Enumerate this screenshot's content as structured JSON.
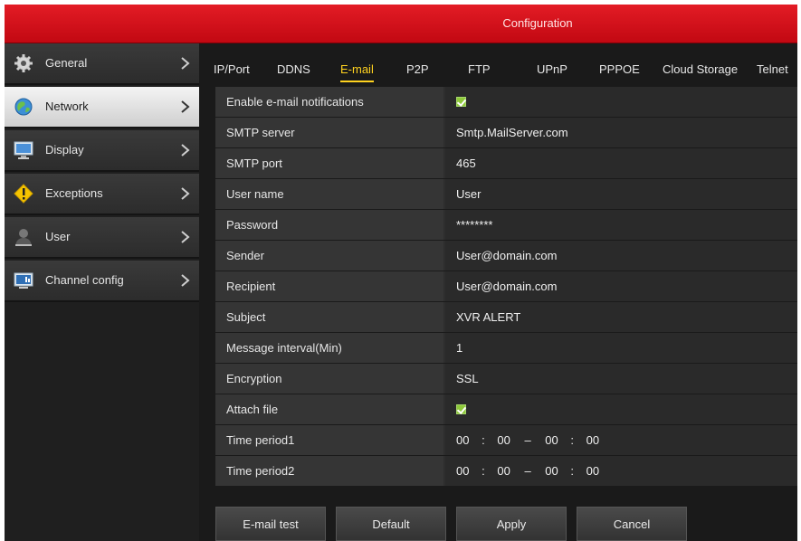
{
  "window": {
    "title": "Configuration"
  },
  "sidebar": {
    "items": [
      {
        "label": "General",
        "icon": "gear-icon"
      },
      {
        "label": "Network",
        "icon": "globe-icon"
      },
      {
        "label": "Display",
        "icon": "monitor-icon"
      },
      {
        "label": "Exceptions",
        "icon": "warning-icon"
      },
      {
        "label": "User",
        "icon": "user-icon"
      },
      {
        "label": "Channel config",
        "icon": "channel-icon"
      }
    ],
    "active": "Network"
  },
  "tabs": [
    {
      "label": "IP/Port"
    },
    {
      "label": "DDNS"
    },
    {
      "label": "E-mail"
    },
    {
      "label": "P2P"
    },
    {
      "label": "FTP"
    },
    {
      "label": "UPnP"
    },
    {
      "label": "PPPOE"
    },
    {
      "label": "Cloud Storage"
    },
    {
      "label": "Telnet"
    }
  ],
  "active_tab": "E-mail",
  "form": {
    "enable_label": "Enable e-mail notifications",
    "enable_checked": true,
    "smtp_server_label": "SMTP server",
    "smtp_server_value": "Smtp.MailServer.com",
    "smtp_port_label": "SMTP port",
    "smtp_port_value": "465",
    "username_label": "User name",
    "username_value": "User",
    "password_label": "Password",
    "password_value": "********",
    "sender_label": "Sender",
    "sender_value": "User@domain.com",
    "recipient_label": "Recipient",
    "recipient_value": "User@domain.com",
    "subject_label": "Subject",
    "subject_value": "XVR ALERT",
    "interval_label": "Message interval(Min)",
    "interval_value": "1",
    "encryption_label": "Encryption",
    "encryption_value": "SSL",
    "attach_label": "Attach file",
    "attach_checked": true,
    "period1_label": "Time period1",
    "period1": {
      "start_h": "00",
      "start_m": "00",
      "end_h": "00",
      "end_m": "00"
    },
    "period2_label": "Time period2",
    "period2": {
      "start_h": "00",
      "start_m": "00",
      "end_h": "00",
      "end_m": "00"
    },
    "sep_colon": ":",
    "sep_dash": "–"
  },
  "buttons": {
    "email_test": "E-mail test",
    "default": "Default",
    "apply": "Apply",
    "cancel": "Cancel"
  },
  "colors": {
    "titlebar": "#d0101a",
    "active_tab": "#ffd21f",
    "checkbox": "#8ec83a"
  }
}
